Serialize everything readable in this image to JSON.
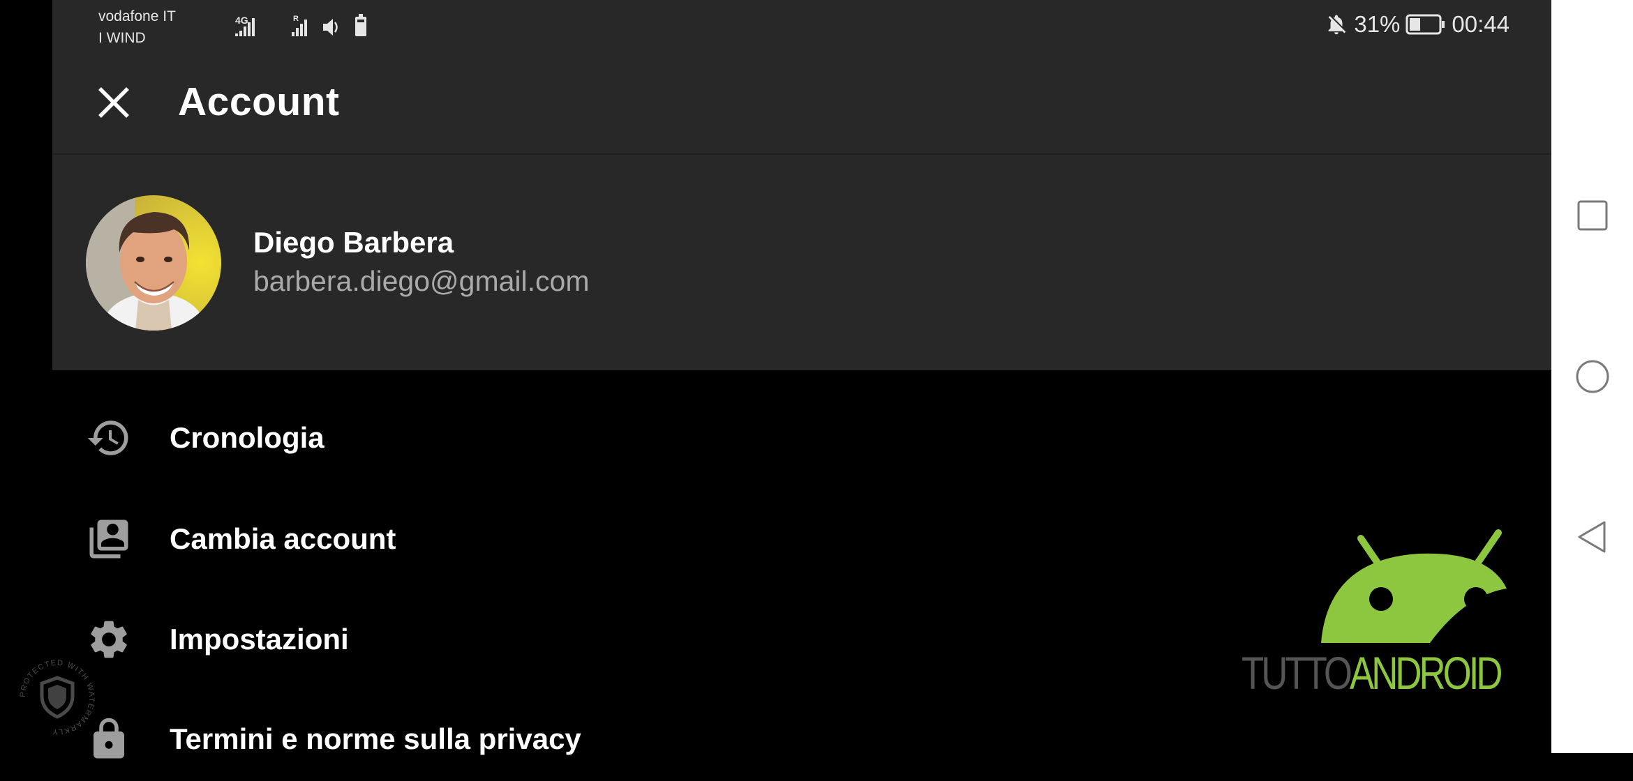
{
  "statusbar": {
    "carrier_1": "vodafone IT",
    "carrier_2": "I WIND",
    "network_type": "4G",
    "roaming_mark": "R",
    "battery_percent": "31%",
    "time": "00:44"
  },
  "header": {
    "title": "Account"
  },
  "profile": {
    "name": "Diego Barbera",
    "email": "barbera.diego@gmail.com"
  },
  "menu": {
    "items": [
      {
        "label": "Cronologia",
        "icon": "history-icon"
      },
      {
        "label": "Cambia account",
        "icon": "switch-account-icon"
      },
      {
        "label": "Impostazioni",
        "icon": "gear-icon"
      },
      {
        "label": "Termini e norme sulla privacy",
        "icon": "lock-icon"
      }
    ]
  },
  "watermark": {
    "logo_text_1": "TUTTO",
    "logo_text_2": "ANDROID",
    "stamp_text": "PROTECTED WITH WATERMARKLY"
  },
  "colors": {
    "bar_bg": "#282828",
    "page_bg": "#000000",
    "accent_green": "#8dc63f",
    "secondary_text": "#aaaaaa"
  },
  "navbar": {
    "buttons": [
      "recents-square-icon",
      "home-circle-icon",
      "back-triangle-icon"
    ]
  }
}
